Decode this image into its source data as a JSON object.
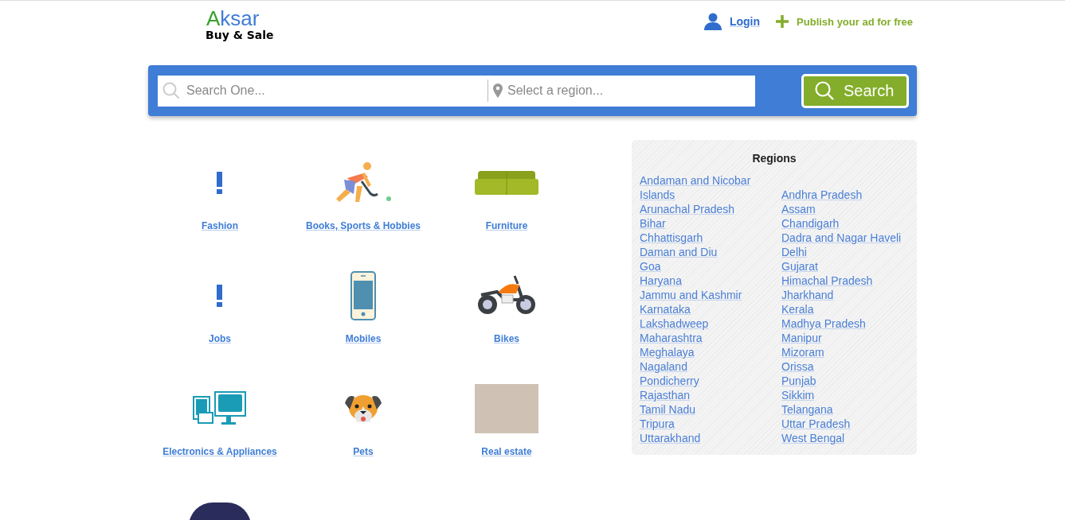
{
  "logo": {
    "initial": "A",
    "rest": "ksar",
    "tagline": "Buy & Sale"
  },
  "header": {
    "login": "Login",
    "publish": "Publish your ad for free"
  },
  "search": {
    "query_placeholder": "Search One...",
    "region_placeholder": "Select a region...",
    "button": "Search"
  },
  "categories": [
    {
      "kind": "icon",
      "label": "Fashion"
    },
    {
      "kind": "icon",
      "label": "Books, Sports & Hobbies"
    },
    {
      "kind": "icon",
      "label": "Furniture"
    },
    {
      "kind": "icon",
      "label": "Jobs"
    },
    {
      "kind": "icon",
      "label": "Mobiles"
    },
    {
      "kind": "icon",
      "label": "Bikes"
    },
    {
      "kind": "icon",
      "label": "Electronics & Appliances"
    },
    {
      "kind": "icon",
      "label": "Pets"
    },
    {
      "kind": "photo",
      "label": "Real estate"
    },
    {
      "kind": "photo"
    }
  ],
  "regions": {
    "title": "Regions",
    "items": [
      "Andaman and Nicobar Islands",
      "Andhra Pradesh",
      "Arunachal Pradesh",
      "Assam",
      "Bihar",
      "Chandigarh",
      "Chhattisgarh",
      "Dadra and Nagar Haveli",
      "Daman and Diu",
      "Delhi",
      "Goa",
      "Gujarat",
      "Haryana",
      "Himachal Pradesh",
      "Jammu and Kashmir",
      "Jharkhand",
      "Karnataka",
      "Kerala",
      "Lakshadweep",
      "Madhya Pradesh",
      "Maharashtra",
      "Manipur",
      "Meghalaya",
      "Mizoram",
      "Nagaland",
      "Orissa",
      "Pondicherry",
      "Punjab",
      "Rajasthan",
      "Sikkim",
      "Tamil Nadu",
      "Telangana",
      "Tripura",
      "Uttar Pradesh",
      "Uttarakhand",
      "West Bengal"
    ]
  }
}
